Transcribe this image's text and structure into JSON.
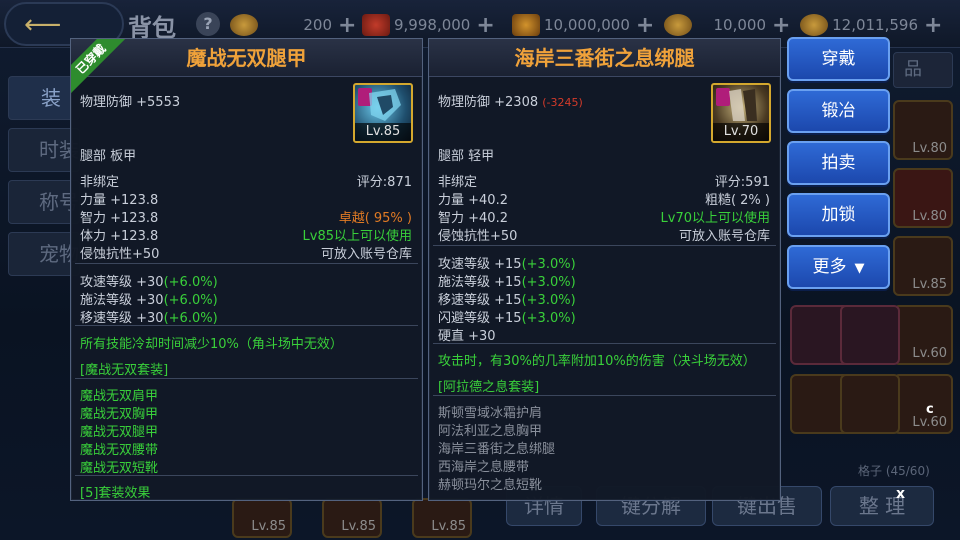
{
  "header": {
    "title": "背包",
    "help": "?",
    "currencies": [
      {
        "value": "200"
      },
      {
        "value": "9,998,000"
      },
      {
        "value": "10,000,000"
      },
      {
        "value": "10,000"
      },
      {
        "value": "12,011,596"
      }
    ],
    "plus": "+"
  },
  "side_tabs": [
    "装备",
    "时装",
    "称号",
    "宠物"
  ],
  "bottom": {
    "detail": "详情",
    "decompose": "键分解",
    "sell": "键出售",
    "sort": "整 理",
    "slot_count": "格子 (45/60)",
    "grid_levels": [
      "Lv.85",
      "Lv.85",
      "Lv.85"
    ],
    "right_levels": [
      "Lv.80",
      "Lv.80",
      "Lv.85",
      "Lv.60",
      "Lv.60"
    ],
    "close": "x",
    "c_mark": "c",
    "partial_label": "品"
  },
  "left_item": {
    "equipped_label": "已穿戴",
    "name": "魔战无双腿甲",
    "defense": "物理防御 +5553",
    "icon_level": "Lv.85",
    "slot_type": "腿部 板甲",
    "bind": "非绑定",
    "score": "评分:871",
    "stats": [
      {
        "label": "力量 +123.8",
        "right": "",
        "right_class": ""
      },
      {
        "label": "智力 +123.8",
        "right": "卓越( 95% )",
        "right_class": "o"
      },
      {
        "label": "体力 +123.8",
        "right": "Lv85以上可以使用",
        "right_class": "g"
      },
      {
        "label": "侵蚀抗性+50",
        "right": "可放入账号仓库",
        "right_class": "w"
      }
    ],
    "speed_stats": [
      {
        "base": "攻速等级 +30",
        "bonus": "(+6.0%)"
      },
      {
        "base": "施法等级 +30",
        "bonus": "(+6.0%)"
      },
      {
        "base": "移速等级 +30",
        "bonus": "(+6.0%)"
      }
    ],
    "special": "所有技能冷却时间减少10%（角斗场中无效）",
    "set_name": "[魔战无双套装]",
    "set_items": [
      "魔战无双肩甲",
      "魔战无双胸甲",
      "魔战无双腿甲",
      "魔战无双腰带",
      "魔战无双短靴"
    ],
    "set_effect": "[5]套装效果"
  },
  "right_item": {
    "name": "海岸三番街之息绑腿",
    "defense": "物理防御 +2308",
    "defense_diff": "(-3245)",
    "icon_level": "Lv.70",
    "slot_type": "腿部 轻甲",
    "bind": "非绑定",
    "score": "评分:591",
    "stats": [
      {
        "label": "力量 +40.2",
        "right": "粗糙( 2% )",
        "right_class": "w"
      },
      {
        "label": "智力 +40.2",
        "right": "Lv70以上可以使用",
        "right_class": "g"
      },
      {
        "label": "侵蚀抗性+50",
        "right": "可放入账号仓库",
        "right_class": "w"
      }
    ],
    "speed_stats": [
      {
        "base": "攻速等级 +15",
        "bonus": "(+3.0%)"
      },
      {
        "base": "施法等级 +15",
        "bonus": "(+3.0%)"
      },
      {
        "base": "移速等级 +15",
        "bonus": "(+3.0%)"
      },
      {
        "base": "闪避等级 +15",
        "bonus": "(+3.0%)"
      },
      {
        "base": "硬直 +30",
        "bonus": ""
      }
    ],
    "special": "攻击时，有30%的几率附加10%的伤害（决斗场无效）",
    "set_name": "[阿拉德之息套装]",
    "set_items": [
      "斯顿雪域冰霜护肩",
      "阿法利亚之息胸甲",
      "海岸三番街之息绑腿",
      "西海岸之息腰带",
      "赫顿玛尔之息短靴"
    ]
  },
  "actions": {
    "equip": "穿戴",
    "forge": "锻冶",
    "auction": "拍卖",
    "lock": "加锁",
    "more": "更多",
    "more_arrow": "▼"
  },
  "colors": {
    "title_orange": "#f0a23a",
    "stat_green": "#39d03a",
    "excellent_orange": "#e07a24",
    "diff_red": "#d33a2a",
    "button_blue": "#2f6ad6"
  }
}
